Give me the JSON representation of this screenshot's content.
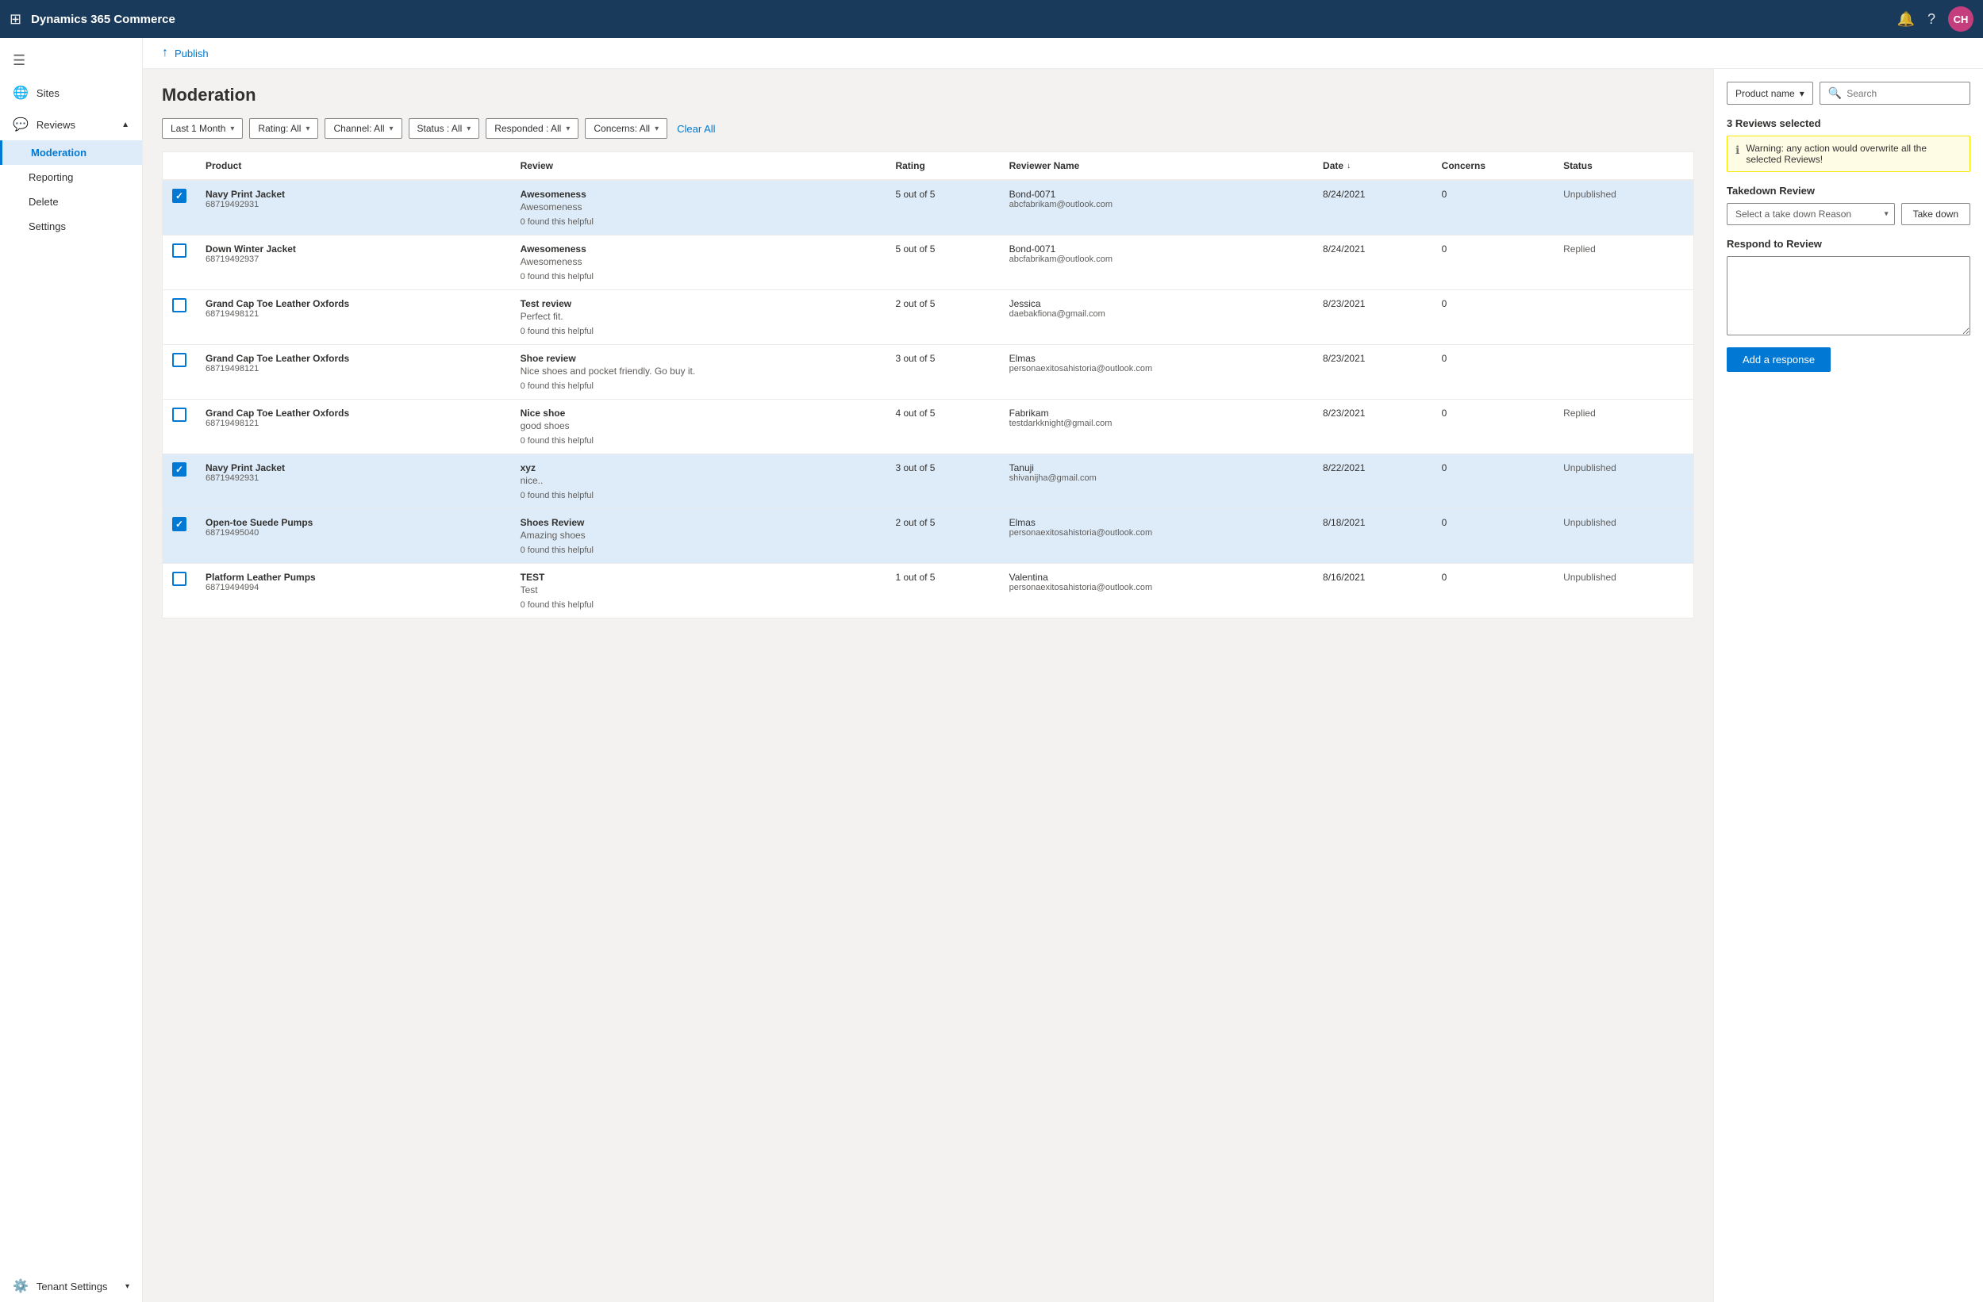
{
  "app": {
    "title": "Dynamics 365 Commerce",
    "avatar_initials": "CH"
  },
  "publish_bar": {
    "label": "Publish"
  },
  "page": {
    "title": "Moderation"
  },
  "sidebar": {
    "hamburger_label": "☰",
    "items": [
      {
        "id": "sites",
        "label": "Sites",
        "icon": "🌐"
      },
      {
        "id": "reviews",
        "label": "Reviews",
        "icon": "💬",
        "expanded": true
      },
      {
        "id": "moderation",
        "label": "Moderation",
        "active": true
      },
      {
        "id": "reporting",
        "label": "Reporting"
      },
      {
        "id": "delete",
        "label": "Delete"
      },
      {
        "id": "settings",
        "label": "Settings"
      },
      {
        "id": "tenant_settings",
        "label": "Tenant Settings",
        "icon": "⚙️"
      }
    ]
  },
  "filters": {
    "date": "Last 1 Month",
    "rating": "Rating: All",
    "channel": "Channel: All",
    "status": "Status : All",
    "responded": "Responded : All",
    "concerns": "Concerns: All",
    "clear_all": "Clear All"
  },
  "table": {
    "columns": [
      "",
      "Product",
      "Review",
      "Rating",
      "Reviewer Name",
      "Date",
      "Concerns",
      "Status"
    ],
    "rows": [
      {
        "selected": true,
        "product_name": "Navy Print Jacket",
        "product_id": "68719492931",
        "review_title": "Awesomeness",
        "review_body": "Awesomeness",
        "helpful": "0 found this helpful",
        "rating": "5 out of 5",
        "reviewer_name": "Bond-0071",
        "reviewer_email": "abcfabrikam@outlook.com",
        "date": "8/24/2021",
        "concerns": "0",
        "status": "Unpublished"
      },
      {
        "selected": false,
        "product_name": "Down Winter Jacket",
        "product_id": "68719492937",
        "review_title": "Awesomeness",
        "review_body": "Awesomeness",
        "helpful": "0 found this helpful",
        "rating": "5 out of 5",
        "reviewer_name": "Bond-0071",
        "reviewer_email": "abcfabrikam@outlook.com",
        "date": "8/24/2021",
        "concerns": "0",
        "status": "Replied"
      },
      {
        "selected": false,
        "product_name": "Grand Cap Toe Leather Oxfords",
        "product_id": "68719498121",
        "review_title": "Test review",
        "review_body": "Perfect fit.",
        "helpful": "0 found this helpful",
        "rating": "2 out of 5",
        "reviewer_name": "Jessica",
        "reviewer_email": "daebakfiona@gmail.com",
        "date": "8/23/2021",
        "concerns": "0",
        "status": ""
      },
      {
        "selected": false,
        "product_name": "Grand Cap Toe Leather Oxfords",
        "product_id": "68719498121",
        "review_title": "Shoe review",
        "review_body": "Nice shoes and pocket friendly. Go buy it.",
        "helpful": "0 found this helpful",
        "rating": "3 out of 5",
        "reviewer_name": "Elmas",
        "reviewer_email": "personaexitosahistoria@outlook.com",
        "date": "8/23/2021",
        "concerns": "0",
        "status": ""
      },
      {
        "selected": false,
        "product_name": "Grand Cap Toe Leather Oxfords",
        "product_id": "68719498121",
        "review_title": "Nice shoe",
        "review_body": "good shoes",
        "helpful": "0 found this helpful",
        "rating": "4 out of 5",
        "reviewer_name": "Fabrikam",
        "reviewer_email": "testdarkknight@gmail.com",
        "date": "8/23/2021",
        "concerns": "0",
        "status": "Replied"
      },
      {
        "selected": true,
        "product_name": "Navy Print Jacket",
        "product_id": "68719492931",
        "review_title": "xyz",
        "review_body": "nice..",
        "helpful": "0 found this helpful",
        "rating": "3 out of 5",
        "reviewer_name": "Tanuji",
        "reviewer_email": "shivanijha@gmail.com",
        "date": "8/22/2021",
        "concerns": "0",
        "status": "Unpublished"
      },
      {
        "selected": true,
        "product_name": "Open-toe Suede Pumps",
        "product_id": "68719495040",
        "review_title": "Shoes Review",
        "review_body": "Amazing shoes",
        "helpful": "0 found this helpful",
        "rating": "2 out of 5",
        "reviewer_name": "Elmas",
        "reviewer_email": "personaexitosahistoria@outlook.com",
        "date": "8/18/2021",
        "concerns": "0",
        "status": "Unpublished"
      },
      {
        "selected": false,
        "product_name": "Platform Leather Pumps",
        "product_id": "68719494994",
        "review_title": "TEST",
        "review_body": "Test",
        "helpful": "0 found this helpful",
        "rating": "1 out of 5",
        "reviewer_name": "Valentina",
        "reviewer_email": "personaexitosahistoria@outlook.com",
        "date": "8/16/2021",
        "concerns": "0",
        "status": "Unpublished"
      }
    ]
  },
  "right_panel": {
    "product_name_label": "Product name",
    "search_placeholder": "Search",
    "selected_count_label": "3 Reviews selected",
    "warning_text": "Warning: any action would overwrite all the selected Reviews!",
    "takedown_section_title": "Takedown Review",
    "takedown_placeholder": "Select a take down Reason",
    "takedown_btn_label": "Take down",
    "respond_section_title": "Respond to Review",
    "respond_placeholder": "",
    "add_response_btn_label": "Add a response"
  }
}
